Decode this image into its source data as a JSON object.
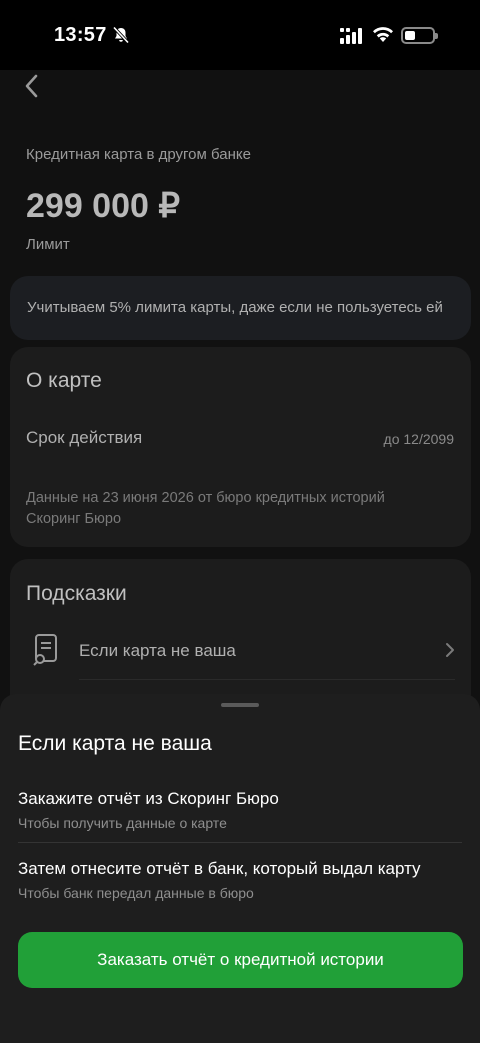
{
  "status_bar": {
    "time": "13:57",
    "icons": [
      "bell-muted-icon",
      "signal-icon",
      "wifi-icon",
      "battery-icon"
    ]
  },
  "header": {
    "back_icon": "chevron-left-icon"
  },
  "card_info": {
    "subtitle": "Кредитная карта в другом банке",
    "amount": "299 000 ₽",
    "amount_label": "Лимит"
  },
  "notice": {
    "text": "Учитываем 5% лимита карты, даже если не пользуетесь ей"
  },
  "about": {
    "title": "О карте",
    "row_label": "Срок действия",
    "row_value": "до 12/2099",
    "note": "Данные на 23 июня 2026 от бюро кредитных историй Скоринг Бюро"
  },
  "hints": {
    "title": "Подсказки",
    "items": [
      {
        "label": "Если карта не ваша",
        "icon": "document-icon"
      }
    ]
  },
  "sheet": {
    "title": "Если карта не ваша",
    "steps": [
      {
        "title": "Закажите отчёт из Скоринг Бюро",
        "subtitle": "Чтобы получить данные о карте"
      },
      {
        "title": "Затем отнесите отчёт в банк, который выдал карту",
        "subtitle": "Чтобы банк передал данные в бюро"
      }
    ],
    "button_label": "Заказать отчёт о кредитной истории"
  },
  "colors": {
    "accent": "#21a038",
    "background": "#111111",
    "card": "#1c1c1c",
    "sheet": "#1e1e1e"
  }
}
